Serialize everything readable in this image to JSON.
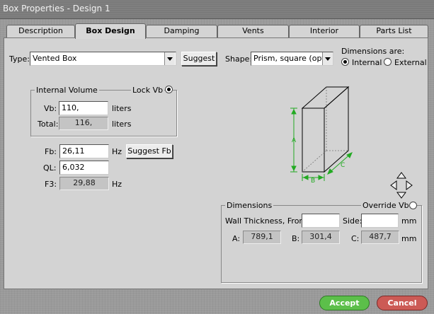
{
  "window": {
    "title": "Box Properties - Design 1"
  },
  "tabs": [
    "Description",
    "Box Design",
    "Damping",
    "Vents",
    "Interior",
    "Parts List"
  ],
  "type": {
    "label": "Type:",
    "value": "Vented Box",
    "suggest_label": "Suggest"
  },
  "shape": {
    "label": "Shape:",
    "value": "Prism, square (opt.)"
  },
  "dimensions_are": {
    "label": "Dimensions are:",
    "internal_label": "Internal",
    "external_label": "External",
    "selected": "Internal"
  },
  "internal_volume": {
    "title": "Internal Volume",
    "lock_label": "Lock Vb",
    "vb_label": "Vb:",
    "vb_value": "110,",
    "vb_unit": "liters",
    "total_label": "Total:",
    "total_value": "116,",
    "total_unit": "liters"
  },
  "tuning": {
    "fb_label": "Fb:",
    "fb_value": "26,11",
    "fb_unit": "Hz",
    "suggest_fb_label": "Suggest Fb",
    "ql_label": "QL:",
    "ql_value": "6,032",
    "f3_label": "F3:",
    "f3_value": "29,88",
    "f3_unit": "Hz"
  },
  "diagram": {
    "label_a": "A",
    "label_b": "B",
    "label_c": "C",
    "dim_color": "#22aa22"
  },
  "dimensions": {
    "title": "Dimensions",
    "override_label": "Override Vb",
    "wall_label": "Wall Thickness, Front:",
    "wall_front_value": "",
    "side_label": "Side:",
    "side_value": "",
    "side_unit": "mm",
    "a_label": "A:",
    "a_value": "789,1",
    "b_label": "B:",
    "b_value": "301,4",
    "c_label": "C:",
    "c_value": "487,7",
    "c_unit": "mm"
  },
  "footer": {
    "accept_label": "Accept",
    "cancel_label": "Cancel",
    "accept_color": "#5cbf4a",
    "cancel_color": "#cc5a55"
  }
}
